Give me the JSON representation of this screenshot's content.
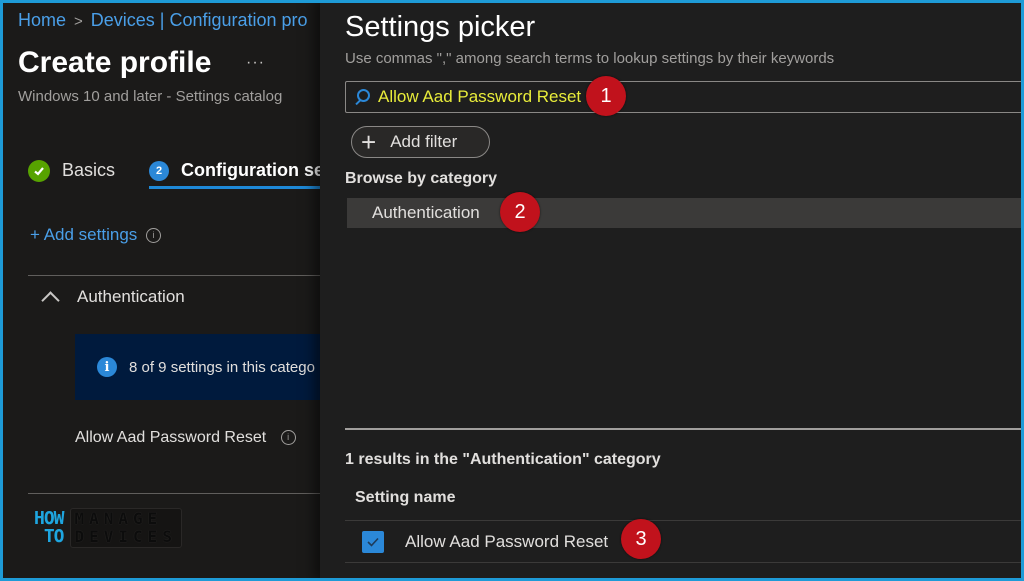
{
  "breadcrumb": {
    "items": [
      "Home",
      "Devices | Configuration pro"
    ]
  },
  "page": {
    "title": "Create profile",
    "more_label": "···",
    "subtitle": "Windows 10 and later - Settings catalog"
  },
  "wizard": {
    "steps": [
      {
        "label": "Basics",
        "status": "complete"
      },
      {
        "number": "2",
        "label": "Configuration se",
        "status": "current"
      }
    ]
  },
  "left_panel": {
    "add_settings_label": "+ Add settings",
    "info_glyph": "i",
    "category": {
      "name": "Authentication",
      "banner_text": "8 of 9 settings in this catego",
      "settings": [
        {
          "name": "Allow Aad Password Reset"
        }
      ]
    },
    "logo": {
      "line1": "HOW",
      "line2": "TO",
      "box_line1": "MANAGE",
      "box_line2": "DEVICES"
    }
  },
  "settings_picker": {
    "title": "Settings picker",
    "description": "Use commas \",\" among search terms to lookup settings by their keywords",
    "search": {
      "value": "Allow Aad Password Reset",
      "placeholder": ""
    },
    "add_filter_label": "Add filter",
    "browse_label": "Browse by category",
    "categories": [
      {
        "name": "Authentication",
        "selected": true
      }
    ],
    "results_label": "1 results in the \"Authentication\" category",
    "column_header": "Setting name",
    "results": [
      {
        "name": "Allow Aad Password Reset",
        "checked": true
      }
    ]
  },
  "markers": [
    "1",
    "2",
    "3"
  ],
  "colors": {
    "accent": "#2b88d8",
    "link": "#4a9fe8",
    "success": "#57a300",
    "marker": "#c1121c",
    "search_text": "#e8ec3a",
    "frame": "#1e9bd7"
  }
}
